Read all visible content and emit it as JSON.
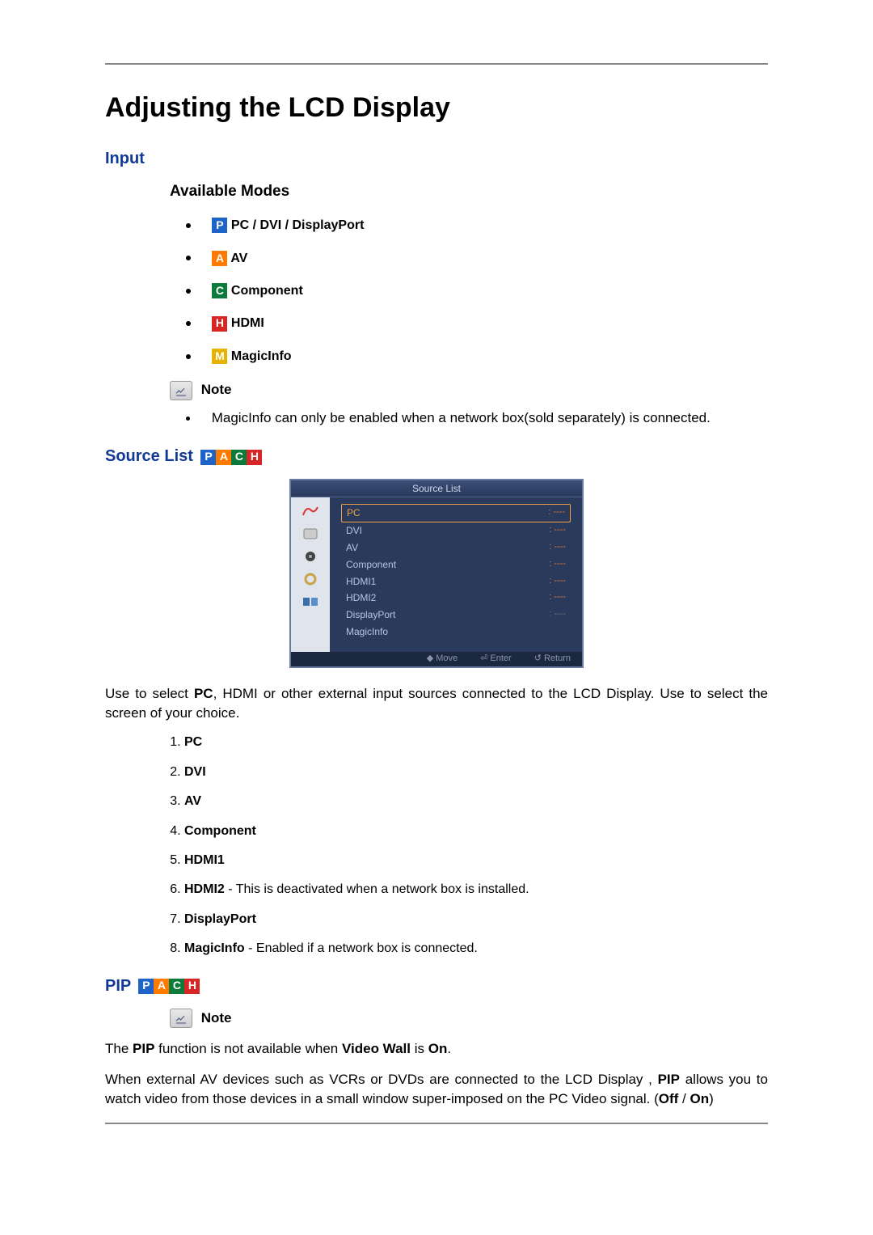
{
  "title": "Adjusting the LCD Display",
  "sections": {
    "input": "Input",
    "available_modes": "Available Modes",
    "source_list": "Source List",
    "pip": "PIP"
  },
  "mode_letters": {
    "P": "P",
    "A": "A",
    "C": "C",
    "H": "H",
    "M": "M"
  },
  "modes": {
    "pc": "PC / DVI / DisplayPort",
    "av": "AV",
    "component": "Component",
    "hdmi": "HDMI",
    "magicinfo": "MagicInfo"
  },
  "note_label": "Note",
  "notes": {
    "magicinfo": "MagicInfo can only be enabled when a network box(sold separately) is connected.",
    "pip_intro1a": "The ",
    "pip_intro1b": "PIP",
    "pip_intro1c": " function is not available when ",
    "pip_intro1d": "Video Wall",
    "pip_intro1e": " is ",
    "pip_intro1f": "On",
    "pip_intro1g": ".",
    "pip_body_a": "When external AV devices such as VCRs or DVDs are connected to the LCD Display , ",
    "pip_body_b": "PIP",
    "pip_body_c": " allows you to watch video from those devices in a small window super-imposed on the PC Video signal. (",
    "pip_body_d": "Off",
    "pip_body_e": " / ",
    "pip_body_f": "On",
    "pip_body_g": ")"
  },
  "osd": {
    "title": "Source List",
    "rows": [
      {
        "label": "PC",
        "val": ": ----",
        "sel": true
      },
      {
        "label": "DVI",
        "val": ": ----"
      },
      {
        "label": "AV",
        "val": ": ----"
      },
      {
        "label": "Component",
        "val": ": ----"
      },
      {
        "label": "HDMI1",
        "val": ": ----"
      },
      {
        "label": "HDMI2",
        "val": ": ----"
      },
      {
        "label": "DisplayPort",
        "val": ": ----"
      },
      {
        "label": "MagicInfo",
        "val": ""
      }
    ],
    "nav": {
      "move": "Move",
      "enter": "Enter",
      "return": "Return"
    }
  },
  "source_desc_a": "Use to select ",
  "source_desc_b": "PC",
  "source_desc_c": ", HDMI or other external input sources connected to the LCD Display. Use to select the screen of your choice.",
  "src_items": {
    "1": {
      "lead": "PC",
      "rest": ""
    },
    "2": {
      "lead": "DVI",
      "rest": ""
    },
    "3": {
      "lead": "AV",
      "rest": ""
    },
    "4": {
      "lead": "Component",
      "rest": ""
    },
    "5": {
      "lead": "HDMI1",
      "rest": ""
    },
    "6": {
      "lead": "HDMI2",
      "rest": " - This is deactivated when a network box is installed."
    },
    "7": {
      "lead": "DisplayPort",
      "rest": ""
    },
    "8": {
      "lead": "MagicInfo",
      "rest": " - Enabled if a network box is connected."
    }
  }
}
